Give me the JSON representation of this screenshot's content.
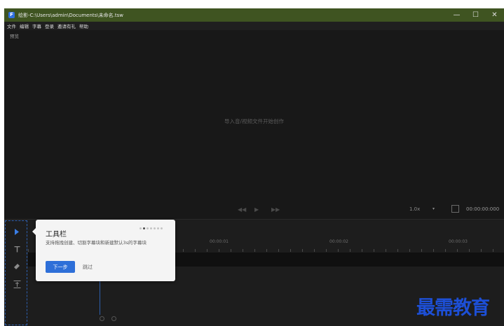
{
  "window": {
    "title": "绘影-C:\\Users\\admin\\Documents\\未命名.tsw",
    "app_icon": "F",
    "controls": {
      "minimize": "—",
      "maximize": "☐",
      "close": "✕"
    }
  },
  "menu": [
    "文件",
    "编辑",
    "字幕",
    "登录",
    "邀请有礼",
    "帮助"
  ],
  "preview": {
    "label": "预览",
    "empty_hint": "导入音/视频文件开始创作",
    "speed": "1.0x",
    "speed_caret": "▾",
    "timecode": "00:00:00:000"
  },
  "timeline": {
    "tick_labels": [
      "00:00:01",
      "00:00:02",
      "00:00:03"
    ]
  },
  "onboarding": {
    "title": "工具栏",
    "description": "支持拖拽创建、切割字幕块和新建默认3s的字幕块",
    "next_label": "下一步",
    "skip_label": "跳过",
    "step_count": 7,
    "current_step": 2
  },
  "watermark": "最需教育",
  "colors": {
    "titlebar": "#3f5421",
    "accent": "#2e6fd8",
    "watermark": "#1d4fd6"
  }
}
